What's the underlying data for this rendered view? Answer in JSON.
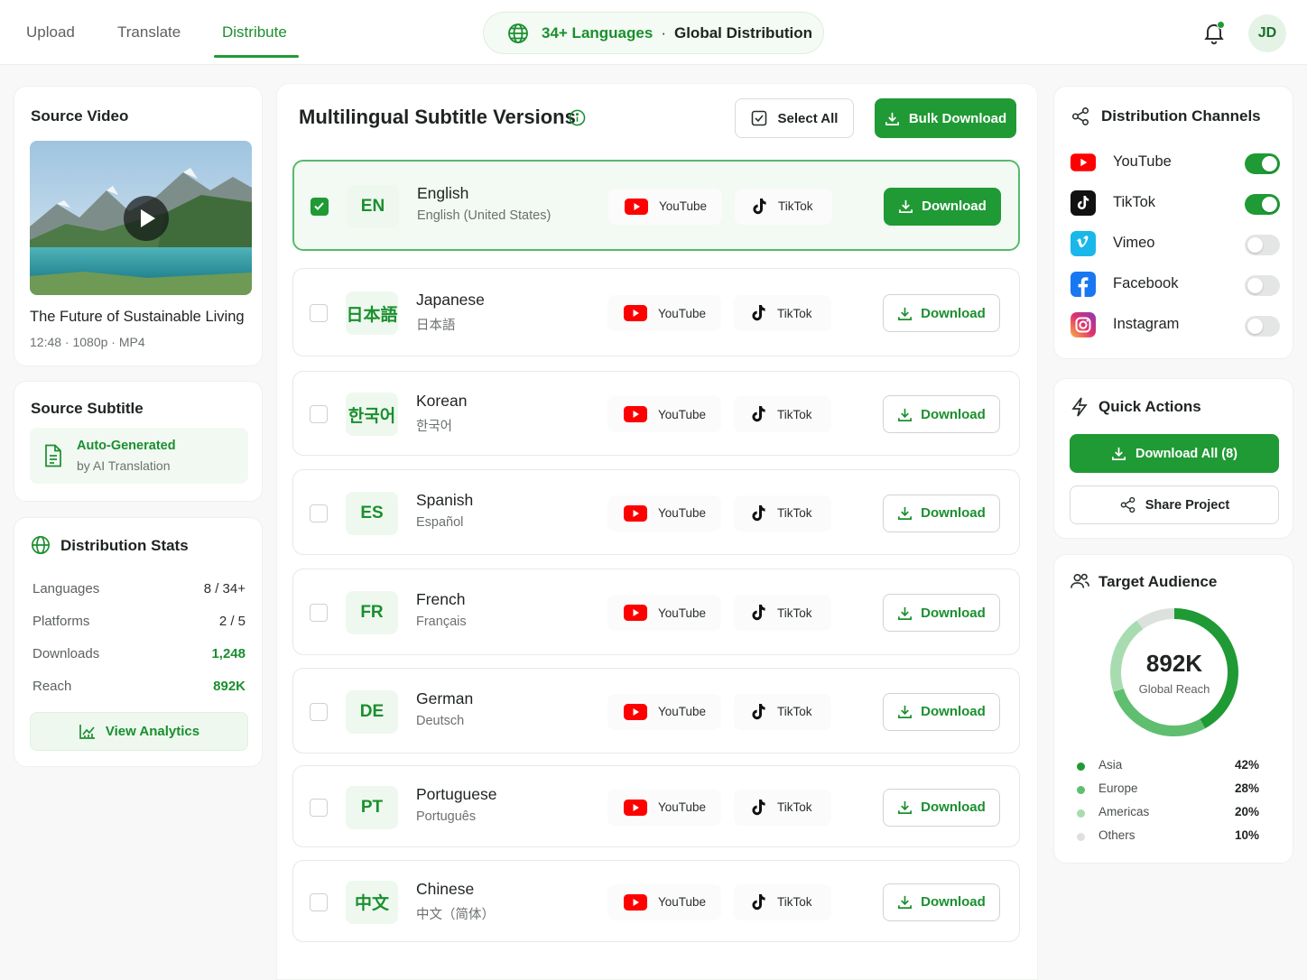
{
  "nav": {
    "tabs": [
      {
        "label": "Upload"
      },
      {
        "label": "Translate"
      },
      {
        "label": "Distribute"
      }
    ],
    "active_tab": "Distribute",
    "pill_languages": "34+ Languages",
    "pill_separator": "·",
    "pill_text": "Global Distribution",
    "user_initials": "JD"
  },
  "source_video": {
    "heading": "Source Video",
    "title": "The Future of Sustainable Living",
    "meta": "12:48 · 1080p · MP4"
  },
  "source_subtitle": {
    "heading": "Source Subtitle",
    "line1": "Auto-Generated",
    "line2": "by AI Translation"
  },
  "stats": {
    "heading": "Distribution Stats",
    "rows": [
      {
        "label": "Languages",
        "value": "8 / 34+"
      },
      {
        "label": "Platforms",
        "value": "2 / 5"
      },
      {
        "label": "Downloads",
        "value": "1,248"
      },
      {
        "label": "Reach",
        "value": "892K"
      }
    ],
    "button": "View Analytics"
  },
  "main": {
    "title": "Multilingual Subtitle Versions",
    "select_all": "Select All",
    "bulk_download": "Bulk Download",
    "platform_youtube": "YouTube",
    "platform_tiktok": "TikTok",
    "download_label": "Download",
    "languages": [
      {
        "code": "EN",
        "name": "English",
        "native": "English (United States)",
        "selected": true
      },
      {
        "code": "日本語",
        "name": "Japanese",
        "native": "日本語",
        "selected": false
      },
      {
        "code": "한국어",
        "name": "Korean",
        "native": "한국어",
        "selected": false
      },
      {
        "code": "ES",
        "name": "Spanish",
        "native": "Español",
        "selected": false
      },
      {
        "code": "FR",
        "name": "French",
        "native": "Français",
        "selected": false
      },
      {
        "code": "DE",
        "name": "German",
        "native": "Deutsch",
        "selected": false
      },
      {
        "code": "PT",
        "name": "Portuguese",
        "native": "Português",
        "selected": false
      },
      {
        "code": "中文",
        "name": "Chinese",
        "native": "中文（简体）",
        "selected": false
      }
    ]
  },
  "channels": {
    "heading": "Distribution Channels",
    "items": [
      {
        "name": "YouTube",
        "enabled": true,
        "icon": "youtube-icon",
        "color": "#ff0000"
      },
      {
        "name": "TikTok",
        "enabled": true,
        "icon": "tiktok-icon",
        "color": "#111111"
      },
      {
        "name": "Vimeo",
        "enabled": false,
        "icon": "vimeo-icon",
        "color": "#1ab7ea"
      },
      {
        "name": "Facebook",
        "enabled": false,
        "icon": "facebook-icon",
        "color": "#1877f2"
      },
      {
        "name": "Instagram",
        "enabled": false,
        "icon": "instagram-icon",
        "color": "#e1306c"
      }
    ]
  },
  "quick_actions": {
    "heading": "Quick Actions",
    "download_all": "Download All (8)",
    "share": "Share Project"
  },
  "audience": {
    "heading": "Target Audience",
    "total": "892K",
    "total_label": "Global Reach",
    "segments": [
      {
        "name": "Asia",
        "percent": "42%",
        "value": 42,
        "color": "#1f9a34"
      },
      {
        "name": "Europe",
        "percent": "28%",
        "value": 28,
        "color": "#5fbf6f"
      },
      {
        "name": "Americas",
        "percent": "20%",
        "value": 20,
        "color": "#a8dcb0"
      },
      {
        "name": "Others",
        "percent": "10%",
        "value": 10,
        "color": "#dde1de"
      }
    ]
  },
  "colors": {
    "accent": "#1f9a34",
    "accent_text": "#1a8f2e"
  }
}
